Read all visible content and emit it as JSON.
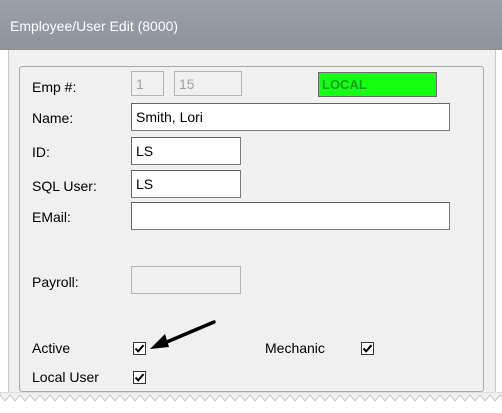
{
  "window": {
    "title": "Employee/User Edit (8000)"
  },
  "form": {
    "emp_label": "Emp #:",
    "emp_prefix": "1",
    "emp_number": "15",
    "location_badge": "LOCAL",
    "name_label": "Name:",
    "name_value": "Smith, Lori",
    "id_label": "ID:",
    "id_value": "LS",
    "sql_user_label": "SQL User:",
    "sql_user_value": "LS",
    "email_label": "EMail:",
    "email_value": "",
    "payroll_label": "Payroll:",
    "payroll_value": "",
    "active_label": "Active",
    "active_checked": true,
    "mechanic_label": "Mechanic",
    "mechanic_checked": true,
    "local_user_label": "Local User",
    "local_user_checked": true
  },
  "colors": {
    "badge_bg": "#15ff15",
    "badge_text": "#1a9c1a",
    "titlebar": "#969ca2"
  },
  "icons": {
    "annotation": "arrow-pointer-icon",
    "check": "checkmark-icon"
  }
}
